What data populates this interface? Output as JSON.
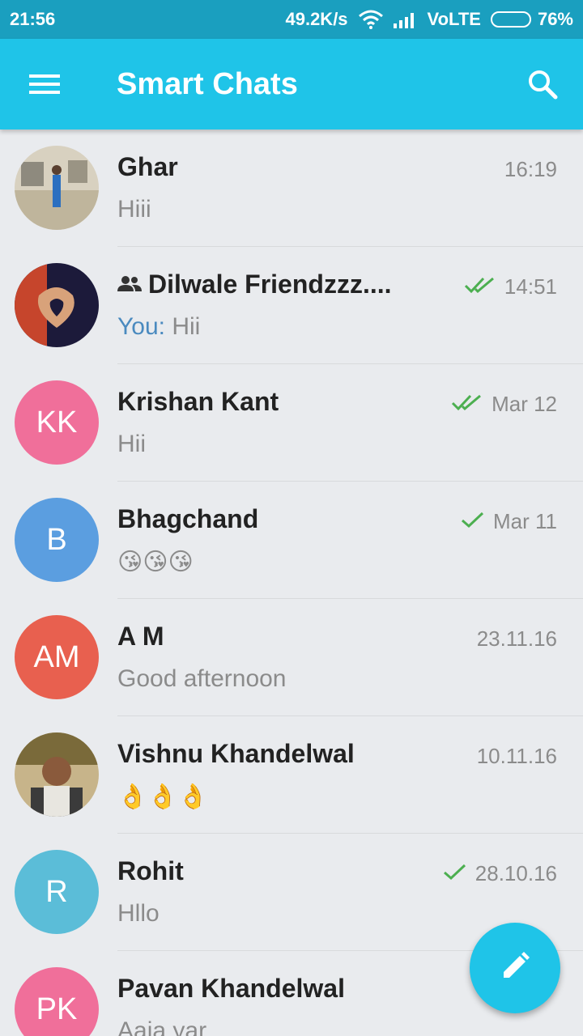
{
  "status_bar": {
    "time": "21:56",
    "net_speed": "49.2K/s",
    "network": "VoLTE",
    "battery": "76%",
    "battery_level": 0.76
  },
  "toolbar": {
    "title": "Smart Chats",
    "menu_icon": "hamburger-menu-icon",
    "search_icon": "search-icon"
  },
  "chats": [
    {
      "name": "Ghar",
      "time": "16:19",
      "preview": "Hiii",
      "status": "none",
      "avatar_type": "photo"
    },
    {
      "name": "Dilwale Friendzzz....",
      "time": "14:51",
      "preview_prefix": "You:",
      "preview": "Hii",
      "status": "read",
      "group": true,
      "avatar_type": "photo"
    },
    {
      "name": "Krishan Kant",
      "time": "Mar 12",
      "preview": "Hii",
      "status": "read",
      "initials": "KK",
      "avatar_color": "#f06f9a"
    },
    {
      "name": "Bhagchand",
      "time": "Mar 11",
      "preview": "😘😘😘",
      "status": "sent",
      "initials": "B",
      "avatar_color": "#5b9ee0"
    },
    {
      "name": "A M",
      "time": "23.11.16",
      "preview": "Good afternoon",
      "status": "none",
      "initials": "AM",
      "avatar_color": "#e8604f"
    },
    {
      "name": "Vishnu Khandelwal",
      "time": "10.11.16",
      "preview": "👌👌👌",
      "status": "none",
      "avatar_type": "photo"
    },
    {
      "name": "Rohit",
      "time": "28.10.16",
      "preview": "Hllo",
      "status": "sent",
      "initials": "R",
      "avatar_color": "#5bbdd8"
    },
    {
      "name": "Pavan Khandelwal",
      "time": "",
      "preview": "Aaja yar",
      "status": "none",
      "initials": "PK",
      "avatar_color": "#f06f9a"
    }
  ],
  "fab": {
    "icon": "pencil-icon"
  },
  "colors": {
    "toolbar": "#1fc4e8",
    "statusbar": "#1a9fbf",
    "checkmark": "#4caf50",
    "you_prefix": "#4a8abf"
  }
}
